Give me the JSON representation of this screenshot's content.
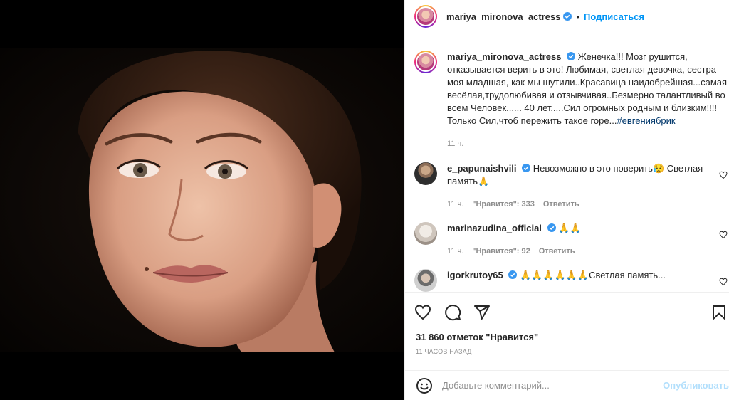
{
  "post": {
    "author": "mariya_mironova_actress",
    "follow_label": "Подписаться",
    "dot": "•",
    "caption": {
      "author": "mariya_mironova_actress",
      "text": "Женечка!!! Мозг рушится, отказывается верить в это! Любимая, светлая девочка, сестра моя младшая, как мы шутили..Красавица наидобрейшая...самая весёлая,трудолюбивая и отзывчивая..Безмерно талантливый во всем Человек...... 40 лет.....Сил огромных родным и близким!!!! Только Сил,чтоб пережить такое горе...",
      "hashtag": "#евгениябрик",
      "time": "11 ч."
    }
  },
  "comments": [
    {
      "author": "e_papunaishvili",
      "text": "Невозможно в это поверить😥 Светлая память🙏",
      "time": "11 ч.",
      "likes": "\"Нравится\": 333",
      "reply": "Ответить"
    },
    {
      "author": "marinazudina_official",
      "text": "🙏🙏",
      "time": "11 ч.",
      "likes": "\"Нравится\": 92",
      "reply": "Ответить"
    },
    {
      "author": "igorkrutoy65",
      "text": "🙏🙏🙏🙏🙏🙏Светлая память..."
    }
  ],
  "stats": {
    "likes": "31 860 отметок \"Нравится\"",
    "time": "11 ЧАСОВ НАЗАД"
  },
  "composer": {
    "placeholder": "Добавьте комментарий...",
    "publish_label": "Опубликовать"
  },
  "icons": {
    "like": "heart-icon",
    "comment": "comment-icon",
    "share": "share-icon",
    "save": "bookmark-icon",
    "emoji": "emoji-icon",
    "verified": "verified-badge-icon"
  },
  "colors": {
    "accent": "#0095f6",
    "verified": "#3897f0",
    "hashtag": "#00376b",
    "muted": "#8e8e8e"
  }
}
